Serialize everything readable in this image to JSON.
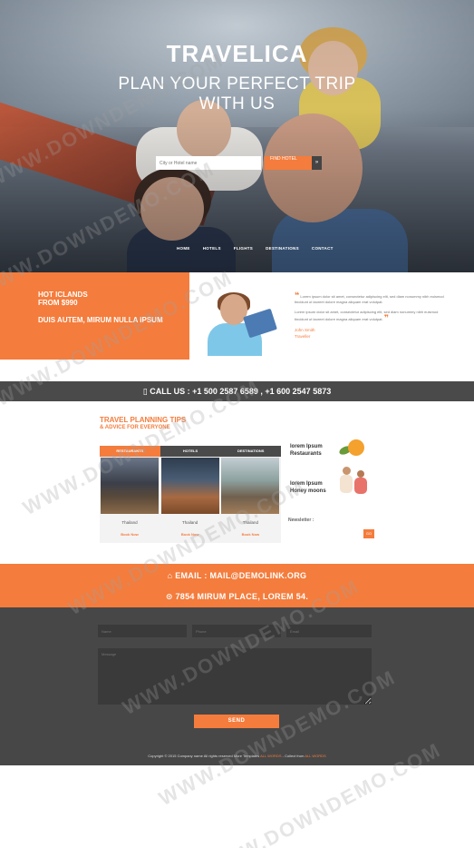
{
  "hero": {
    "brand": "TRAVELICA",
    "tagline_line1": "PLAN YOUR PERFECT TRIP",
    "tagline_line2": "WITH US",
    "search_placeholder": "City or Hotel name",
    "search_button": "FIND HOTEL",
    "search_go": "»",
    "nav": [
      "HOME",
      "HOTELS",
      "FLIGHTS",
      "DESTINATIONS",
      "CONTACT"
    ]
  },
  "offer": {
    "line1": "HOT ICLANDS",
    "line2": "FROM $990",
    "line3": "DUIS AUTEM, MIRUM NULLA IPSUM"
  },
  "testimonial": {
    "open_quote": "❝",
    "close_quote": "❞",
    "para1": "Lorem ipsum dolor sit amet, consectetur adipiscing elit, sed diam nonummy nibh euismod tincidunt ut laoreet dolore magna aliquam erat volutpat.",
    "para2": "Lorem ipsum dolor sit amet, consectetur adipiscing elit, sed diam nonummy nibh euismod tincidunt ut laoreet dolore magna aliquam erat volutpat.",
    "author_name": "John Smith",
    "author_role": "Traveller"
  },
  "call": {
    "text": "▯ CALL US : +1 500 2587 6589 , +1 600 2547 5873"
  },
  "tips": {
    "title": "TRAVEL PLANNING TIPS",
    "subtitle": "& ADVICE FOR EVERYONE",
    "tabs": [
      "RESTAURANTS",
      "HOTELS",
      "DESTINATIONS"
    ],
    "cards": [
      {
        "name": "Thailand",
        "action": "Book Now"
      },
      {
        "name": "Thailand",
        "action": "Book Now"
      },
      {
        "name": "Thailand",
        "action": "Book Now"
      }
    ],
    "side": [
      {
        "line1": "lorem Ipsum",
        "line2": "Restaurants"
      },
      {
        "line1": "lorem Ipsum",
        "line2": "Honey moons"
      }
    ],
    "newsletter_label": "Newsletter :",
    "newsletter_button": "GO"
  },
  "contact": {
    "email": "⌂ EMAIL : MAIL@DEMOLINK.ORG",
    "address": "⊙ 7854 MIRUM PLACE, LOREM 54."
  },
  "form": {
    "name_placeholder": "Name",
    "phone_placeholder": "Phone",
    "email_placeholder": "Email",
    "message_placeholder": "Message",
    "send": "SEND"
  },
  "footer": {
    "copyright": "Copyright © 2015 Company name All rights reserved More Templates",
    "link1": "ALL WORDS",
    "collect": "- Collect from",
    "link2": "ALL WORDS"
  },
  "watermark": "WWW.DOWNDEMO.COM",
  "colors": {
    "accent": "#f47c3c",
    "dark": "#4a4a4a",
    "form_bg": "#474747"
  }
}
